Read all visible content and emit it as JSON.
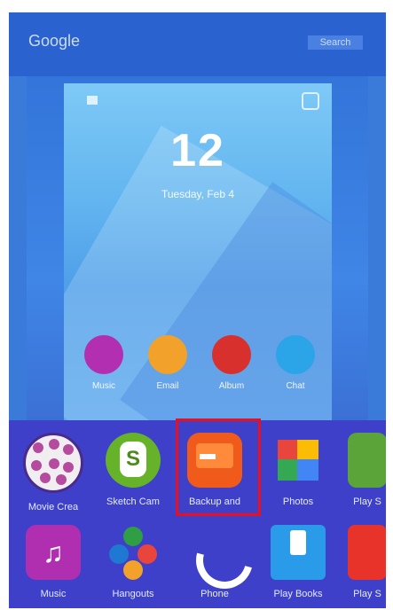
{
  "top_bar": {
    "label": "Google",
    "right_label": "Search"
  },
  "preview": {
    "clock": "12",
    "date": "Tuesday, Feb 4"
  },
  "dock": [
    {
      "label": "Music",
      "color": "#b12fb0"
    },
    {
      "label": "Email",
      "color": "#f2a12a"
    },
    {
      "label": "Album",
      "color": "#d8302d"
    },
    {
      "label": "Chat",
      "color": "#2ba4e8"
    }
  ],
  "apps_row1": [
    {
      "label": "Movie Crea",
      "icon": "movie-icon"
    },
    {
      "label": "Sketch Cam",
      "icon": "sketch-icon"
    },
    {
      "label": "Backup and",
      "icon": "backup-icon"
    },
    {
      "label": "Photos",
      "icon": "photos-icon"
    },
    {
      "label": "Play S",
      "icon": "play-store-icon"
    }
  ],
  "apps_row2": [
    {
      "label": "Music",
      "icon": "music-icon"
    },
    {
      "label": "Hangouts",
      "icon": "hangouts-icon"
    },
    {
      "label": "Phone",
      "icon": "phone-icon"
    },
    {
      "label": "Play Books",
      "icon": "play-books-icon"
    },
    {
      "label": "Play S",
      "icon": "play-app-icon"
    }
  ],
  "colors": {
    "accent_highlight": "#e8101f",
    "tray_bg": "#3e40c9"
  }
}
